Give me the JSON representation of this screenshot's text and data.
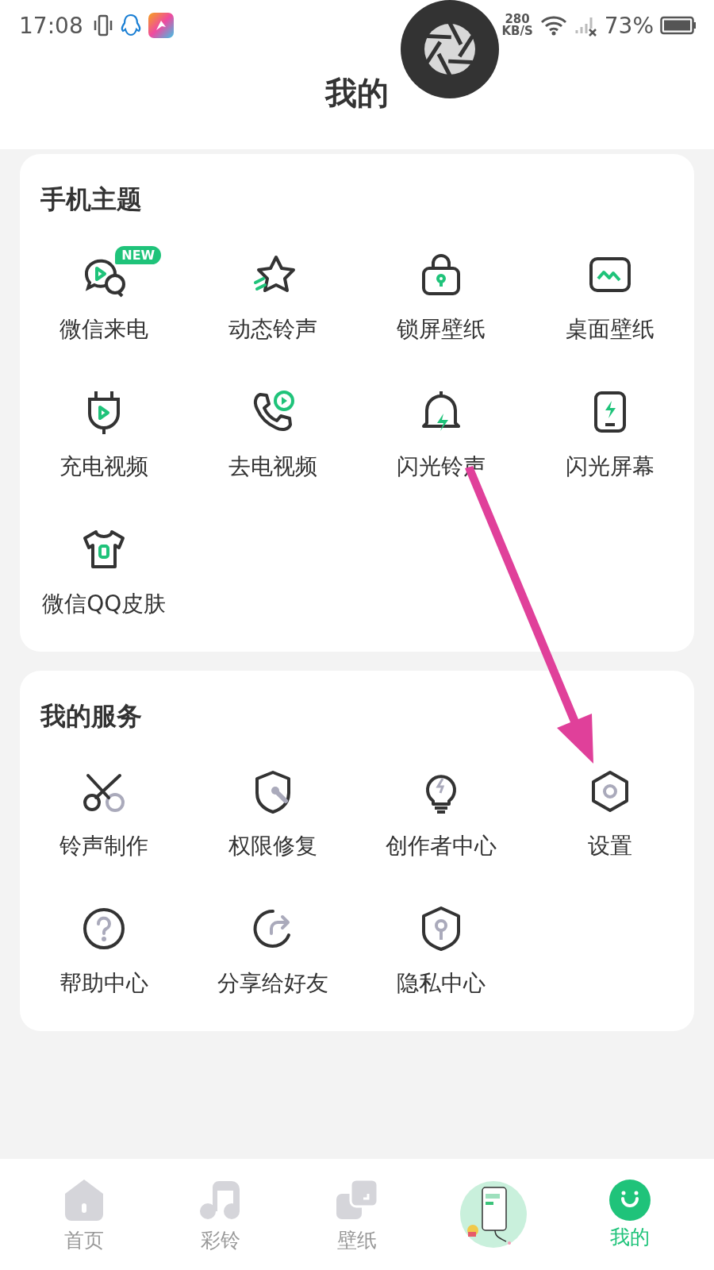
{
  "status_bar": {
    "time": "17:08",
    "speed_value": "280",
    "speed_unit": "KB/S",
    "battery": "73%"
  },
  "header": {
    "title": "我的"
  },
  "sections": [
    {
      "title": "手机主题",
      "items": [
        {
          "label": "微信来电",
          "badge": "NEW"
        },
        {
          "label": "动态铃声"
        },
        {
          "label": "锁屏壁纸"
        },
        {
          "label": "桌面壁纸"
        },
        {
          "label": "充电视频"
        },
        {
          "label": "去电视频"
        },
        {
          "label": "闪光铃声"
        },
        {
          "label": "闪光屏幕"
        },
        {
          "label": "微信QQ皮肤"
        }
      ]
    },
    {
      "title": "我的服务",
      "items": [
        {
          "label": "铃声制作"
        },
        {
          "label": "权限修复"
        },
        {
          "label": "创作者中心"
        },
        {
          "label": "设置"
        },
        {
          "label": "帮助中心"
        },
        {
          "label": "分享给好友"
        },
        {
          "label": "隐私中心"
        }
      ]
    }
  ],
  "bottom_nav": [
    {
      "kind": "tab",
      "label": "首页",
      "selected": false
    },
    {
      "kind": "tab",
      "label": "彩铃",
      "selected": false
    },
    {
      "kind": "tab",
      "label": "壁纸",
      "selected": false
    },
    {
      "kind": "picture"
    },
    {
      "kind": "tab",
      "label": "我的",
      "selected": true
    }
  ]
}
